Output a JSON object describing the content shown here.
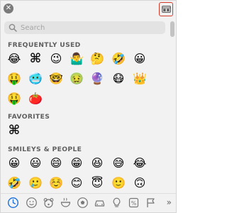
{
  "search": {
    "placeholder": "Search",
    "value": ""
  },
  "sections": [
    {
      "title": "FREQUENTLY USED",
      "rows": [
        [
          "😂",
          "⌘",
          "😉",
          "🤷‍♂️",
          "🤔",
          "🤣",
          "😀"
        ],
        [
          "🤑",
          "🥶",
          "🤓",
          "🤢",
          "🔮",
          "😷",
          "👑"
        ],
        [
          "🤑",
          "🍅"
        ]
      ]
    },
    {
      "title": "FAVORITES",
      "rows": [
        [
          "⌘"
        ]
      ]
    },
    {
      "title": "SMILEYS & PEOPLE",
      "rows": [
        [
          "😀",
          "😃",
          "😄",
          "😁",
          "😆",
          "😅",
          "😂"
        ],
        [
          "🤣",
          "🥲",
          "☺️",
          "😊",
          "😇",
          "🙂",
          "🙃"
        ]
      ]
    }
  ],
  "categories": [
    {
      "name": "clock-icon",
      "active": true
    },
    {
      "name": "smiley-icon"
    },
    {
      "name": "animal-icon"
    },
    {
      "name": "food-icon"
    },
    {
      "name": "ball-icon"
    },
    {
      "name": "car-icon"
    },
    {
      "name": "lightbulb-icon"
    },
    {
      "name": "symbols-icon"
    },
    {
      "name": "flag-icon"
    }
  ],
  "more_label": "»",
  "colors": {
    "accent": "#1a6fe0",
    "highlight_border": "#d23a2a",
    "panel_bg": "#f2f2f2"
  }
}
